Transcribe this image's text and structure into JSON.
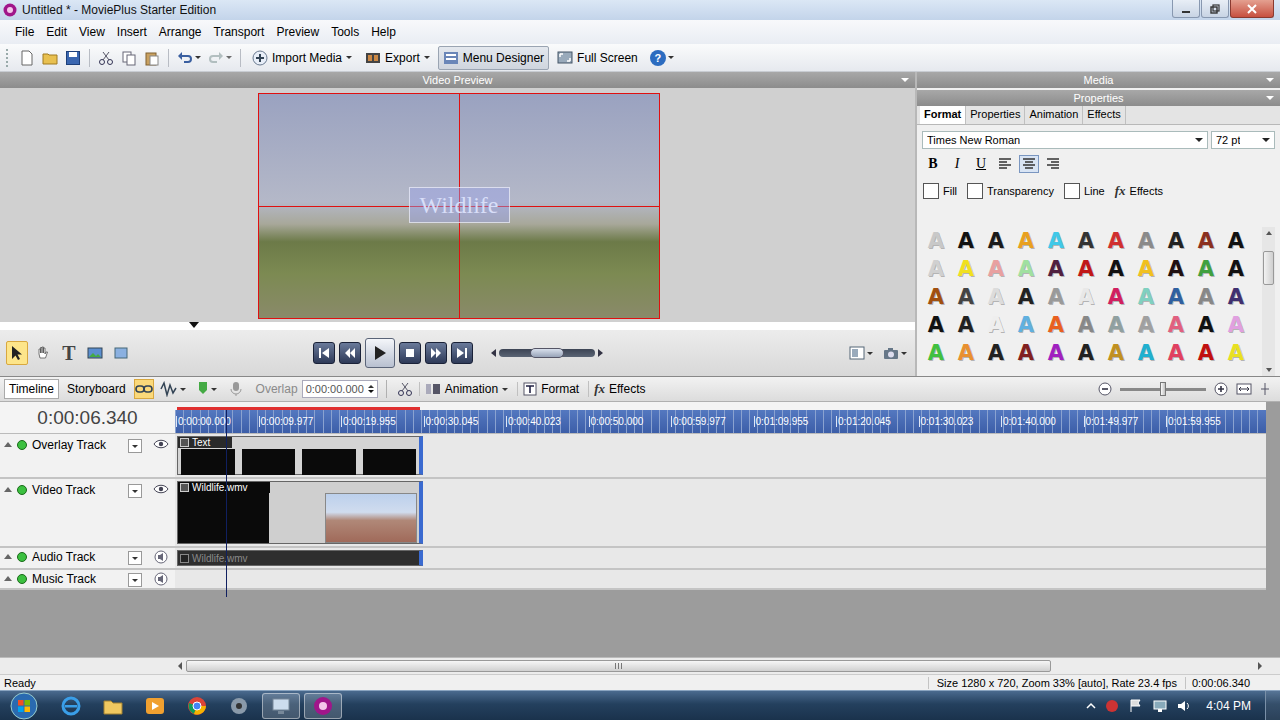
{
  "window": {
    "title": "Untitled * - MoviePlus Starter Edition"
  },
  "menu": [
    "File",
    "Edit",
    "View",
    "Insert",
    "Arrange",
    "Transport",
    "Preview",
    "Tools",
    "Help"
  ],
  "toolbar": {
    "buttons": [
      {
        "label": "Import Media",
        "kind": "import",
        "dropdown": true,
        "pressed": false
      },
      {
        "label": "Export",
        "kind": "export",
        "dropdown": true,
        "pressed": false
      },
      {
        "label": "Menu Designer",
        "kind": "menu",
        "dropdown": false,
        "pressed": true
      },
      {
        "label": "Full Screen",
        "kind": "fullscreen",
        "dropdown": false,
        "pressed": false
      }
    ],
    "help_glyph": "?"
  },
  "preview": {
    "title": "Video Preview",
    "overlay_text": "Wildlife",
    "tools": [
      {
        "kind": "pointer",
        "glyph": "",
        "selected": true
      },
      {
        "kind": "pan",
        "glyph": "",
        "selected": false
      },
      {
        "kind": "text",
        "glyph": "T",
        "selected": false
      },
      {
        "kind": "image",
        "glyph": "",
        "selected": false
      },
      {
        "kind": "shape",
        "glyph": "",
        "selected": false
      }
    ],
    "transport": [
      {
        "kind": "prev-marker"
      },
      {
        "kind": "step-back"
      },
      {
        "kind": "play"
      },
      {
        "kind": "stop"
      },
      {
        "kind": "step-forward"
      },
      {
        "kind": "next-marker"
      }
    ],
    "scrub": {
      "level": 0.5
    }
  },
  "properties": {
    "media_title": "Media",
    "title": "Properties",
    "tabs": [
      {
        "label": "Format",
        "selected": true
      },
      {
        "label": "Properties",
        "selected": false
      },
      {
        "label": "Animation",
        "selected": false
      },
      {
        "label": "Effects",
        "selected": false
      }
    ],
    "font": "Times New Roman",
    "size": "72 pt",
    "styles": [
      {
        "label": "B",
        "kind": "bold",
        "on": false
      },
      {
        "label": "I",
        "kind": "italic",
        "on": false
      },
      {
        "label": "U",
        "kind": "underline",
        "on": false
      }
    ],
    "alignment": [
      {
        "kind": "left",
        "selected": false
      },
      {
        "kind": "center",
        "selected": true
      },
      {
        "kind": "right",
        "selected": false
      }
    ],
    "options": [
      {
        "label": "Fill",
        "checked": false
      },
      {
        "label": "Transparency",
        "checked": false
      },
      {
        "label": "Line",
        "checked": false
      }
    ],
    "effects": {
      "glyph": "fx",
      "label": "Effects"
    },
    "presets_scroll": {
      "level": 0.3
    },
    "presets": [
      {
        "glyph": "A",
        "color": "#c8c8c8"
      },
      {
        "glyph": "A",
        "color": "#111111"
      },
      {
        "glyph": "A",
        "color": "#1a1a1a"
      },
      {
        "glyph": "A",
        "color": "#e8a020"
      },
      {
        "glyph": "A",
        "color": "#40c8e8"
      },
      {
        "glyph": "A",
        "color": "#333333"
      },
      {
        "glyph": "A",
        "color": "#d03030"
      },
      {
        "glyph": "A",
        "color": "#8a8a8a"
      },
      {
        "glyph": "A",
        "color": "#222222"
      },
      {
        "glyph": "A",
        "color": "#8a3020"
      },
      {
        "glyph": "A",
        "color": "#111111"
      },
      {
        "glyph": "A",
        "color": "#d0d0d0"
      },
      {
        "glyph": "A",
        "color": "#f0e020"
      },
      {
        "glyph": "A",
        "color": "#e8a0a0"
      },
      {
        "glyph": "A",
        "color": "#a0e0a0"
      },
      {
        "glyph": "A",
        "color": "#502040"
      },
      {
        "glyph": "A",
        "color": "#c01818"
      },
      {
        "glyph": "A",
        "color": "#111111"
      },
      {
        "glyph": "A",
        "color": "#f0c020"
      },
      {
        "glyph": "A",
        "color": "#201010"
      },
      {
        "glyph": "A",
        "color": "#40a040"
      },
      {
        "glyph": "A",
        "color": "#111111"
      },
      {
        "glyph": "A",
        "color": "#a05010"
      },
      {
        "glyph": "A",
        "color": "#444444"
      },
      {
        "glyph": "A",
        "color": "#dcdcdc"
      },
      {
        "glyph": "A",
        "color": "#222222"
      },
      {
        "glyph": "A",
        "color": "#9a9a9a"
      },
      {
        "glyph": "A",
        "color": "#e8e8e8"
      },
      {
        "glyph": "A",
        "color": "#d02060"
      },
      {
        "glyph": "A",
        "color": "#80d0c0"
      },
      {
        "glyph": "A",
        "color": "#3060a0"
      },
      {
        "glyph": "A",
        "color": "#888888"
      },
      {
        "glyph": "A",
        "color": "#403070"
      },
      {
        "glyph": "A",
        "color": "#111111"
      },
      {
        "glyph": "A",
        "color": "#222222"
      },
      {
        "glyph": "A",
        "color": "#eeeeee"
      },
      {
        "glyph": "A",
        "color": "#60b0e0"
      },
      {
        "glyph": "A",
        "color": "#e86020"
      },
      {
        "glyph": "A",
        "color": "#888888"
      },
      {
        "glyph": "A",
        "color": "#90a0a0"
      },
      {
        "glyph": "A",
        "color": "#a0a0a0"
      },
      {
        "glyph": "A",
        "color": "#e06080"
      },
      {
        "glyph": "A",
        "color": "#111111"
      },
      {
        "glyph": "A",
        "color": "#e0a0e0"
      },
      {
        "glyph": "A",
        "color": "#40c040"
      },
      {
        "glyph": "A",
        "color": "#e89030"
      },
      {
        "glyph": "A",
        "color": "#222222"
      },
      {
        "glyph": "A",
        "color": "#802020"
      },
      {
        "glyph": "A",
        "color": "#a020c0"
      },
      {
        "glyph": "A",
        "color": "#222222"
      },
      {
        "glyph": "A",
        "color": "#c09020"
      },
      {
        "glyph": "A",
        "color": "#20b0d0"
      },
      {
        "glyph": "A",
        "color": "#e04060"
      },
      {
        "glyph": "A",
        "color": "#c01010"
      },
      {
        "glyph": "A",
        "color": "#e8e020"
      }
    ]
  },
  "timeline": {
    "tabs": [
      {
        "label": "Timeline",
        "selected": true
      },
      {
        "label": "Storyboard",
        "selected": false
      }
    ],
    "snap": {
      "on": true
    },
    "overlap": {
      "label": "Overlap",
      "value": "0:00:00.000",
      "disabled": true
    },
    "buttons": [
      {
        "label": "Animation",
        "kind": "animation",
        "glyph": "",
        "dropdown": true
      },
      {
        "label": "Format",
        "kind": "format",
        "glyph": "",
        "dropdown": false
      },
      {
        "label": "Effects",
        "kind": "effects",
        "glyph": "fx",
        "dropdown": false
      }
    ],
    "zoom": {
      "level": 0.5
    },
    "time": "0:00:06.340",
    "ruler": [
      "0:00:00.000",
      "0:00:09.977",
      "0:00:19.955",
      "0:00:30.045",
      "0:00:40.023",
      "0:00:50.000",
      "0:00:59.977",
      "0:01:09.955",
      "0:01:20.045",
      "0:01:30.023",
      "0:01:40.000",
      "0:01:49.977",
      "0:01:59.955"
    ],
    "playhead": {
      "level": 0.047
    },
    "duration": {
      "level": 0.223
    },
    "tracks": [
      {
        "name": "Overlay Track",
        "kind": "overlay",
        "enabled": true,
        "visible": true,
        "clips": [
          {
            "label": "Text",
            "kind": "text"
          }
        ]
      },
      {
        "name": "Video Track",
        "kind": "video",
        "enabled": true,
        "visible": true,
        "clips": [
          {
            "label": "Wildlife.wmv",
            "kind": "video"
          }
        ]
      },
      {
        "name": "Audio Track",
        "kind": "audio",
        "enabled": true,
        "visible": true,
        "clips": [
          {
            "label": "Wildlife.wmv",
            "kind": "audio"
          }
        ]
      },
      {
        "name": "Music Track",
        "kind": "music",
        "enabled": true,
        "visible": true,
        "clips": []
      }
    ],
    "scrollbar": {
      "level": 0.81
    }
  },
  "status_bar": {
    "left": "Ready",
    "info": "Size 1280 x 720, Zoom 33% [auto], Rate 23.4 fps",
    "time": "0:00:06.340"
  },
  "taskbar": {
    "apps": [
      {
        "kind": "ie",
        "running": false
      },
      {
        "kind": "explorer",
        "running": false
      },
      {
        "kind": "media",
        "running": false
      },
      {
        "kind": "chrome",
        "running": false
      },
      {
        "kind": "settings",
        "running": false
      },
      {
        "kind": "monitor",
        "running": true
      },
      {
        "kind": "movieplus",
        "running": true
      }
    ],
    "clock": "4:04 PM"
  }
}
